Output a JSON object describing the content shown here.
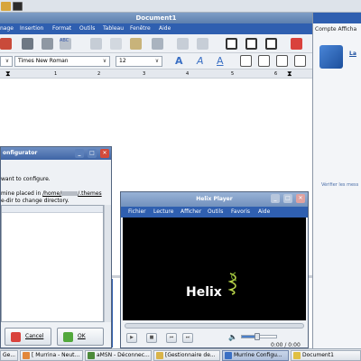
{
  "writer": {
    "title": "Document1",
    "menu": [
      "nage",
      "Insertion",
      "Format",
      "Outils",
      "Tableau",
      "Fenêtre",
      "Aide"
    ],
    "style_combo_arrow": "∨",
    "font": "Times New Roman",
    "size": "12",
    "ruler_ticks": [
      "1",
      "2",
      "3",
      "4",
      "5",
      "6"
    ]
  },
  "right_panel": {
    "menu": "Compte  Afficha",
    "name_link": "La",
    "verify_link": "Vérifier les mess"
  },
  "config": {
    "title": "onfigurator",
    "line1": "want to configure.",
    "line2_pre": "mine placed in ",
    "line2_path": "/home/",
    "line2_post": "/.themes",
    "line3": "e-dir to change directory.",
    "cancel": "Cancel",
    "ok": "OK"
  },
  "helix": {
    "title": "Helix Player",
    "menu": [
      "Fichier",
      "Lecture",
      "Afficher",
      "Outils",
      "Favoris",
      "Aide"
    ],
    "logo": "Helix",
    "time": "0:00 / 0:00",
    "volume_fraction": 0.45
  },
  "taskbar": {
    "items": [
      "Ge...",
      "[ Murrina - Neut...",
      "aMSN - Déconnec...",
      "[Gestionnaire de...",
      "Murrine Configu...",
      "Document1"
    ],
    "active_index": 4
  },
  "colors": {
    "menubar": "#2f5fb0",
    "title_gradient_top": "#7f9ec6",
    "accent": "#2f5fb0"
  },
  "icons": {
    "topstrip": [
      "app-menu-icon",
      "terminal-icon"
    ],
    "toolbar1": [
      "image-icon",
      "print-icon",
      "print-preview-icon",
      "spellcheck-icon",
      "cut-icon",
      "copy-icon",
      "paste-icon",
      "format-brush-icon",
      "undo-icon",
      "redo-icon",
      "view-normal-icon",
      "view-web-icon",
      "view-print-icon",
      "styles-icon"
    ],
    "toolbar2": [
      "bold-icon",
      "italic-icon",
      "underline-icon",
      "align-left-icon",
      "align-center-icon",
      "align-right-icon",
      "justify-icon"
    ]
  }
}
